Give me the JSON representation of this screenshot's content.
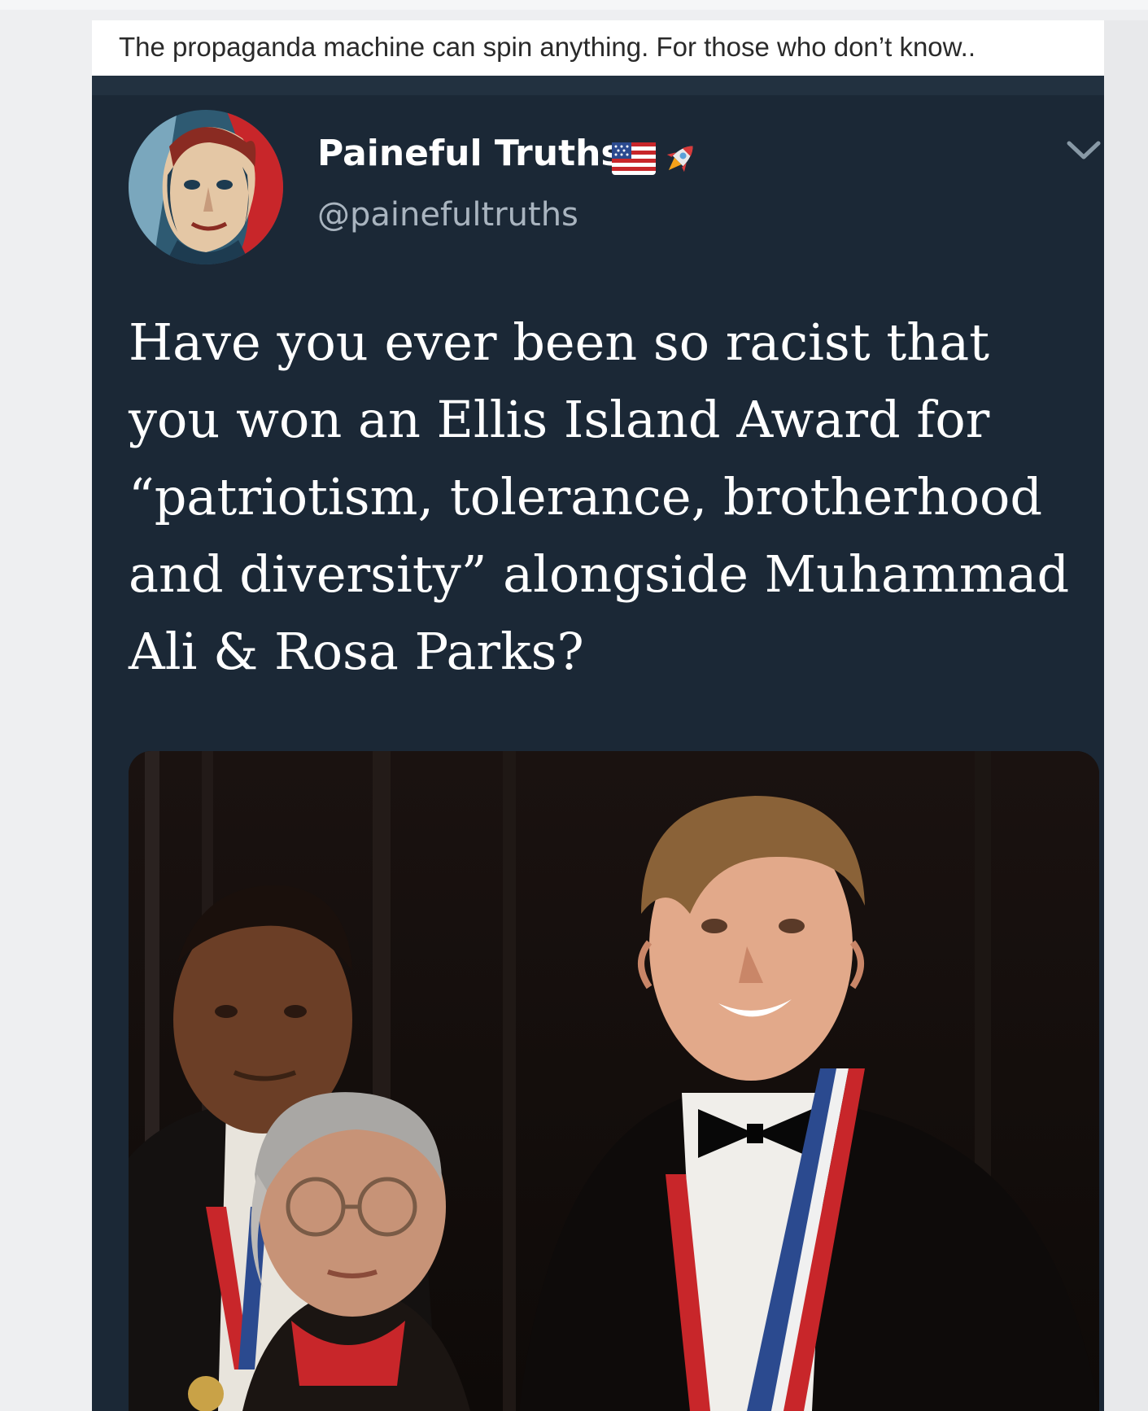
{
  "post": {
    "caption": "The propaganda machine can spin anything. For those who don’t know.."
  },
  "tweet": {
    "display_name": "Paineful Truths",
    "handle": "@painefultruths",
    "emojis": [
      "us-flag-icon",
      "rocket-icon"
    ],
    "body_lines": [
      "Have you ever been so racist that",
      "you won an Ellis Island Award for",
      "“patriotism, tolerance, brotherhood",
      "and diversity” alongside Muhammad",
      "Ali & Rosa Parks?"
    ]
  },
  "colors": {
    "tweet_background": "#1b2836",
    "tweet_topbar": "#223140",
    "handle_text": "#a9b4bf",
    "chevron": "#8899a6",
    "page_background": "#eeeff1"
  }
}
